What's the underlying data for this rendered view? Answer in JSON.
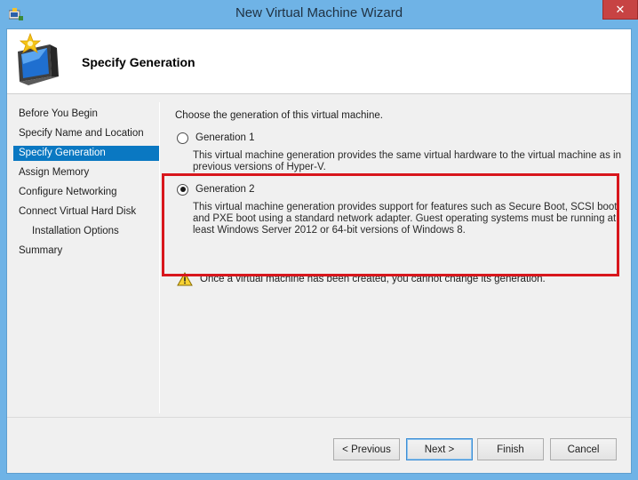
{
  "window": {
    "title": "New Virtual Machine Wizard",
    "close_label": "✕"
  },
  "header": {
    "title": "Specify Generation"
  },
  "sidebar": {
    "items": [
      {
        "label": "Before You Begin",
        "active": false,
        "sub": false
      },
      {
        "label": "Specify Name and Location",
        "active": false,
        "sub": false
      },
      {
        "label": "Specify Generation",
        "active": true,
        "sub": false
      },
      {
        "label": "Assign Memory",
        "active": false,
        "sub": false
      },
      {
        "label": "Configure Networking",
        "active": false,
        "sub": false
      },
      {
        "label": "Connect Virtual Hard Disk",
        "active": false,
        "sub": false
      },
      {
        "label": "Installation Options",
        "active": false,
        "sub": true
      },
      {
        "label": "Summary",
        "active": false,
        "sub": false
      }
    ]
  },
  "main": {
    "intro": "Choose the generation of this virtual machine.",
    "gen1": {
      "label": "Generation 1",
      "selected": false,
      "desc": "This virtual machine generation provides the same virtual hardware to the virtual machine as in previous versions of Hyper-V."
    },
    "gen2": {
      "label": "Generation 2",
      "selected": true,
      "desc": "This virtual machine generation provides support for features such as Secure Boot, SCSI boot, and PXE boot using a standard network adapter. Guest operating systems must be running at least Windows Server 2012 or 64-bit versions of Windows 8."
    },
    "warning": "Once a virtual machine has been created, you cannot change its generation."
  },
  "buttons": {
    "previous": "< Previous",
    "next": "Next >",
    "finish": "Finish",
    "cancel": "Cancel"
  },
  "colors": {
    "titlebar": "#6fb3e6",
    "active_nav": "#0a78c2",
    "highlight": "#d8161c",
    "close": "#c74343"
  },
  "icons": {
    "app": "hyperv-app-icon",
    "header": "new-vm-wizard-icon",
    "warning": "warning-icon"
  }
}
